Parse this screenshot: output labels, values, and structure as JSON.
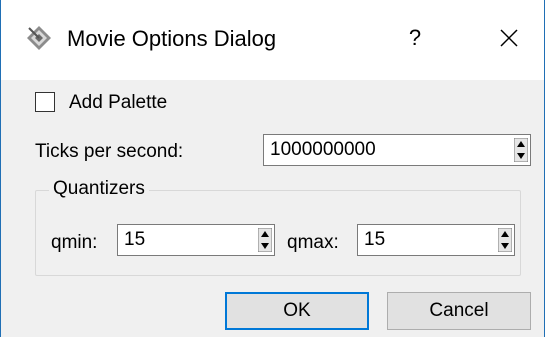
{
  "window": {
    "title": "Movie Options Dialog",
    "help_label": "?"
  },
  "options": {
    "add_palette_label": "Add Palette",
    "add_palette_checked": false,
    "ticks_label": "Ticks per second:",
    "ticks_value": "1000000000"
  },
  "quantizers": {
    "title": "Quantizers",
    "qmin_label": "qmin:",
    "qmin_value": "15",
    "qmax_label": "qmax:",
    "qmax_value": "15"
  },
  "buttons": {
    "ok_label": "OK",
    "cancel_label": "Cancel"
  },
  "colors": {
    "window_border": "#1f6fb5",
    "focus_border": "#0078d7",
    "dialog_background": "#f0f0f0"
  },
  "icons": {
    "app": "app-logo-icon",
    "close": "close-icon",
    "spin": "spin-arrows-icon"
  }
}
